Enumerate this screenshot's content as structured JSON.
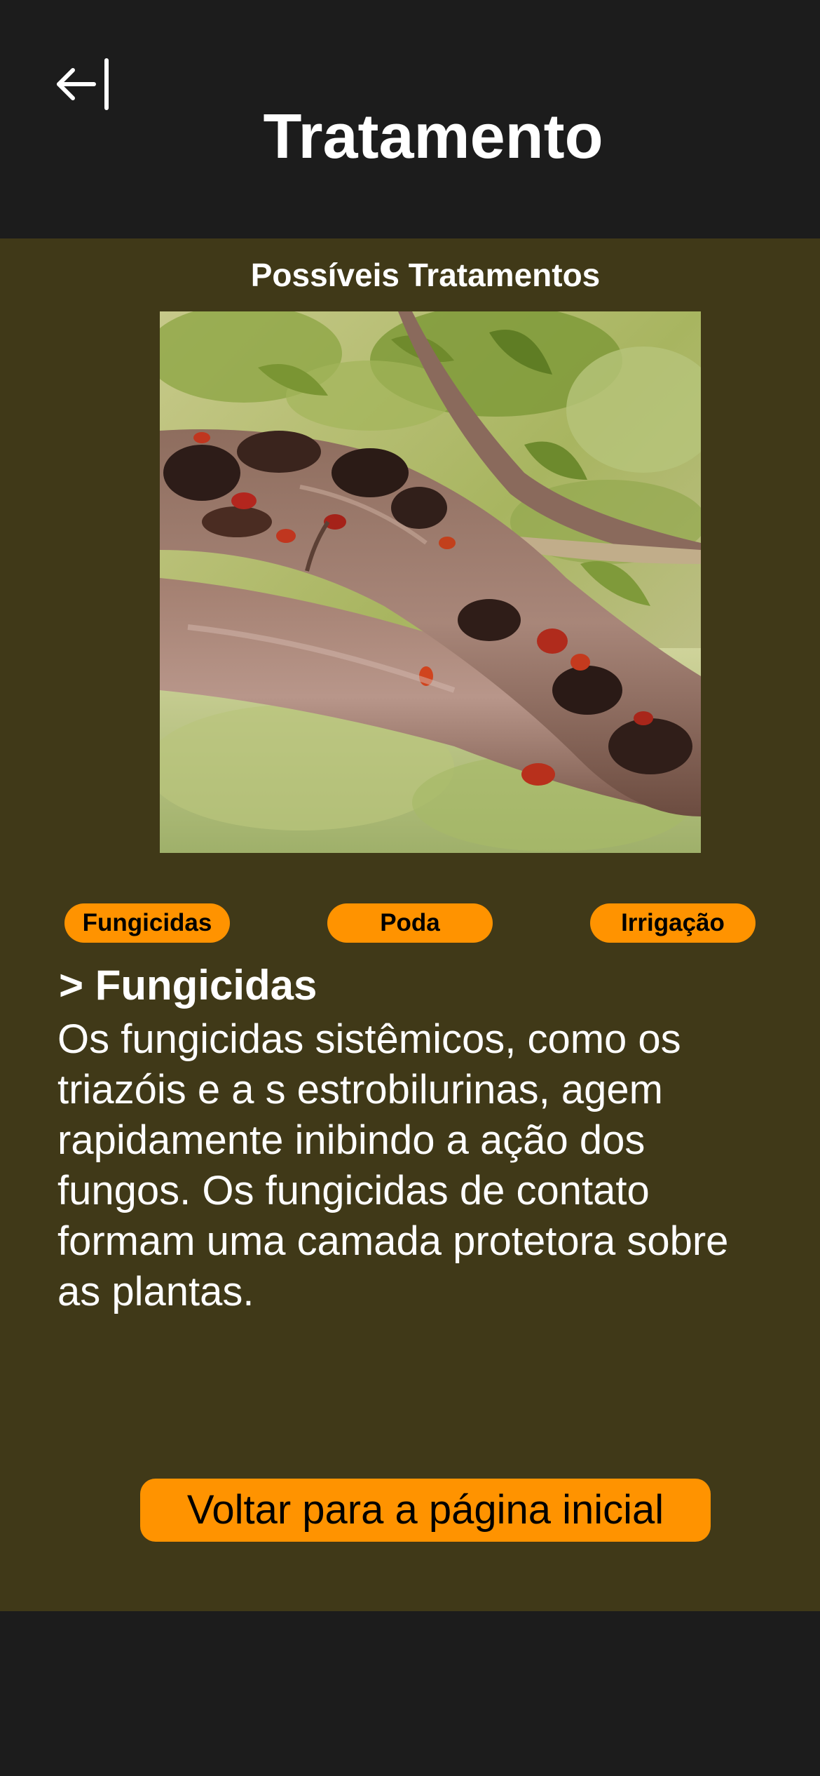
{
  "header": {
    "back_icon": "arrow-left-to-line-icon",
    "title": "Tratamento"
  },
  "main": {
    "section_title": "Possíveis Tratamentos",
    "image_subject": "tree-branch-with-gummosis-photo",
    "tabs": [
      {
        "label": "Fungicidas"
      },
      {
        "label": "Poda"
      },
      {
        "label": "Irrigação"
      }
    ],
    "detail": {
      "heading": "> Fungicidas",
      "text": "Os fungicidas sistêmicos, como os triazóis e a s estrobilurinas, agem rapidamente inibindo a ação dos fungos. Os fungicidas de contato formam uma camada protetora sobre as plantas."
    },
    "home_button_label": "Voltar para a página inicial"
  },
  "colors": {
    "background_dark": "#1c1c1c",
    "content_background": "#403918",
    "accent": "#ff9300",
    "text_light": "#ffffff",
    "text_dark": "#000000"
  }
}
